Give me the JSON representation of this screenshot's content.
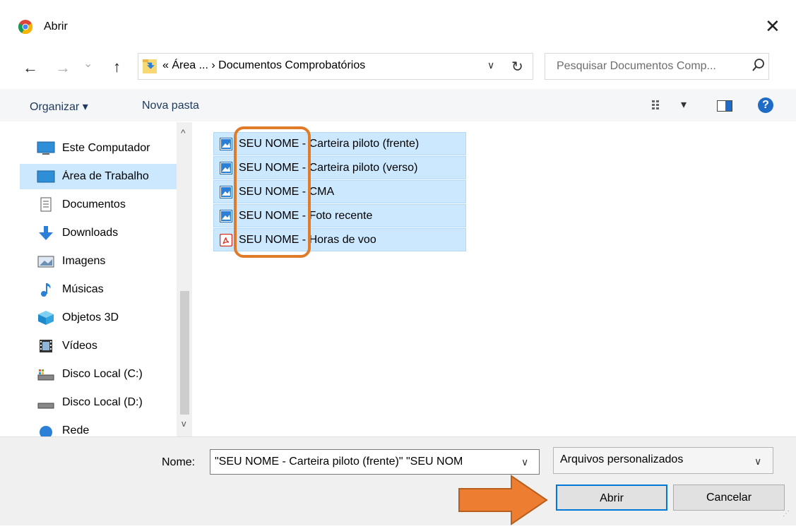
{
  "window": {
    "title": "Abrir",
    "close_glyph": "✕",
    "app_icon": "chrome-icon"
  },
  "nav": {
    "back_glyph": "←",
    "forward_glyph": "→",
    "recent_glyph": "⌄",
    "up_glyph": "↑",
    "breadcrumb": "« Área ...  ›  Documentos Comprobatórios",
    "refresh_glyph": "↻",
    "dropdown_glyph": "∨",
    "search_placeholder": "Pesquisar Documentos Comp..."
  },
  "toolbar": {
    "organize_label": "Organizar ▾",
    "new_folder_label": "Nova pasta",
    "view_glyph": "▾",
    "help_glyph": "?"
  },
  "sidebar": {
    "items": [
      {
        "label": "Este Computador",
        "icon": "computer-icon"
      },
      {
        "label": "Área de Trabalho",
        "icon": "desktop-icon"
      },
      {
        "label": "Documentos",
        "icon": "documents-icon"
      },
      {
        "label": "Downloads",
        "icon": "download-icon"
      },
      {
        "label": "Imagens",
        "icon": "pictures-icon"
      },
      {
        "label": "Músicas",
        "icon": "music-icon"
      },
      {
        "label": "Objetos 3D",
        "icon": "3d-objects-icon"
      },
      {
        "label": "Vídeos",
        "icon": "videos-icon"
      },
      {
        "label": "Disco Local (C:)",
        "icon": "drive-c-icon"
      },
      {
        "label": "Disco Local (D:)",
        "icon": "drive-d-icon"
      },
      {
        "label": "Rede",
        "icon": "network-icon"
      }
    ],
    "scroll_up_glyph": "^",
    "scroll_down_glyph": "v"
  },
  "files": [
    {
      "prefix": "SEU NOME",
      "suffix": " - Carteira piloto (frente)",
      "icon": "image-file-icon"
    },
    {
      "prefix": "SEU NOME",
      "suffix": " - Carteira piloto (verso)",
      "icon": "image-file-icon"
    },
    {
      "prefix": "SEU NOME",
      "suffix": " - CMA",
      "icon": "image-file-icon"
    },
    {
      "prefix": "SEU NOME",
      "suffix": " - Foto recente",
      "icon": "image-file-icon"
    },
    {
      "prefix": "SEU NOME",
      "suffix": " - Horas de voo",
      "icon": "pdf-file-icon"
    }
  ],
  "footer": {
    "name_label": "Nome:",
    "name_value": "\"SEU NOME - Carteira piloto (frente)\" \"SEU NOM",
    "file_type": "Arquivos personalizados",
    "open_label": "Abrir",
    "cancel_label": "Cancelar"
  },
  "colors": {
    "selection": "#cce8ff",
    "accent": "#0078d7",
    "annotation": "#e07b29"
  }
}
